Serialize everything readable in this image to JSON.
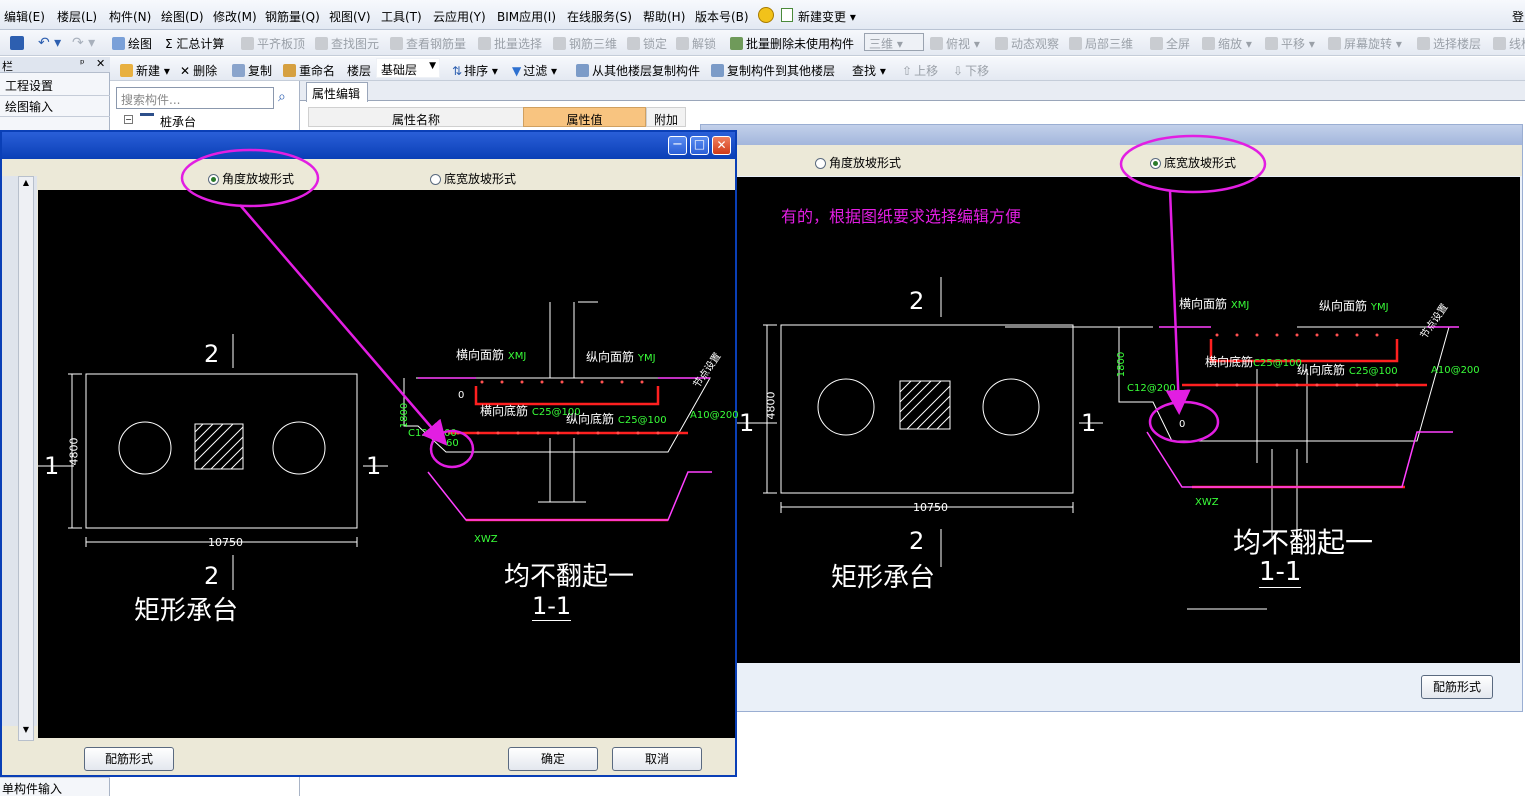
{
  "menu": [
    "编辑(E)",
    "楼层(L)",
    "构件(N)",
    "绘图(D)",
    "修改(M)",
    "钢筋量(Q)",
    "视图(V)",
    "工具(T)",
    "云应用(Y)",
    "BIM应用(I)",
    "在线服务(S)",
    "帮助(H)",
    "版本号(B)",
    "新建变更 ▾"
  ],
  "menu_right": "登",
  "toolbar1": [
    "绘图",
    "Σ 汇总计算",
    "平齐板顶",
    "查找图元",
    "查看钢筋量",
    "批量选择",
    "钢筋三维",
    "锁定",
    "解锁",
    "批量删除未使用构件",
    "三维",
    "俯视",
    "动态观察",
    "局部三维",
    "全屏",
    "缩放",
    "平移",
    "屏幕旋转",
    "选择楼层",
    "线框"
  ],
  "toolbar2": {
    "new": "新建 ▾",
    "delete": "删除",
    "copy": "复制",
    "rename": "重命名",
    "floor_label": "楼层",
    "floor_value": "基础层",
    "sort": "排序 ▾",
    "filter": "过滤 ▾",
    "copy_from": "从其他楼层复制构件",
    "copy_to": "复制构件到其他楼层",
    "find": "查找 ▾",
    "up": "上移",
    "down": "下移"
  },
  "left_panel": {
    "title": "栏",
    "items": [
      "工程设置",
      "绘图输入"
    ],
    "bottom": "单构件输入"
  },
  "tree": {
    "search_placeholder": "搜索构件...",
    "root": "桩承台"
  },
  "props": {
    "tab": "属性编辑",
    "col_name": "属性名称",
    "col_value": "属性值",
    "col_extra": "附加"
  },
  "dialog_left": {
    "radio_angle": "角度放坡形式",
    "radio_width": "底宽放坡形式",
    "btn_rebar": "配筋形式",
    "btn_ok": "确定",
    "btn_cancel": "取消",
    "drawing": {
      "plan_title": "矩形承台",
      "section_title_a": "均不翻起一",
      "section_title_b": "1-1",
      "mark_1": "1",
      "mark_2": "2",
      "dim_w": "10750",
      "dim_h": "4800",
      "l_top_t": "横向面筋",
      "l_top_t_code": "XMJ",
      "l_top_l": "纵向面筋",
      "l_top_l_code": "YMJ",
      "l_bot_t": "横向底筋",
      "l_bot_t_code": "C25@100",
      "l_bot_l": "纵向底筋",
      "l_bot_l_code": "C25@100",
      "side_a": "A10@200",
      "side_c": "C12@200",
      "side_h": "1800",
      "xwz": "XWZ",
      "angle": "60",
      "zero": "0",
      "note": "节点设置"
    }
  },
  "dialog_right": {
    "radio_angle": "角度放坡形式",
    "radio_width": "底宽放坡形式",
    "annotation": "有的，根据图纸要求选择编辑方便",
    "btn_rebar": "配筋形式",
    "drawing": {
      "plan_title": "矩形承台",
      "section_title_a": "均不翻起一",
      "section_title_b": "1-1",
      "mark_1": "1",
      "mark_2": "2",
      "dim_w": "10750",
      "dim_h": "4800",
      "l_top_t": "横向面筋",
      "l_top_t_code": "XMJ",
      "l_top_l": "纵向面筋",
      "l_top_l_code": "YMJ",
      "l_bot_t": "横向底筋",
      "l_bot_t_code": "C25@100",
      "l_bot_l": "纵向底筋",
      "l_bot_l_code": "C25@100",
      "side_a": "A10@200",
      "side_c": "C12@200",
      "side_h": "1800",
      "xwz": "XWZ",
      "zero": "0",
      "note": "节点设置"
    }
  },
  "colors": {
    "annotation": "#e21ee2",
    "title_active": "#0a3fb6",
    "cad_bg": "#000000",
    "rebar": "#ff2020",
    "dim_green": "#39ff39"
  }
}
